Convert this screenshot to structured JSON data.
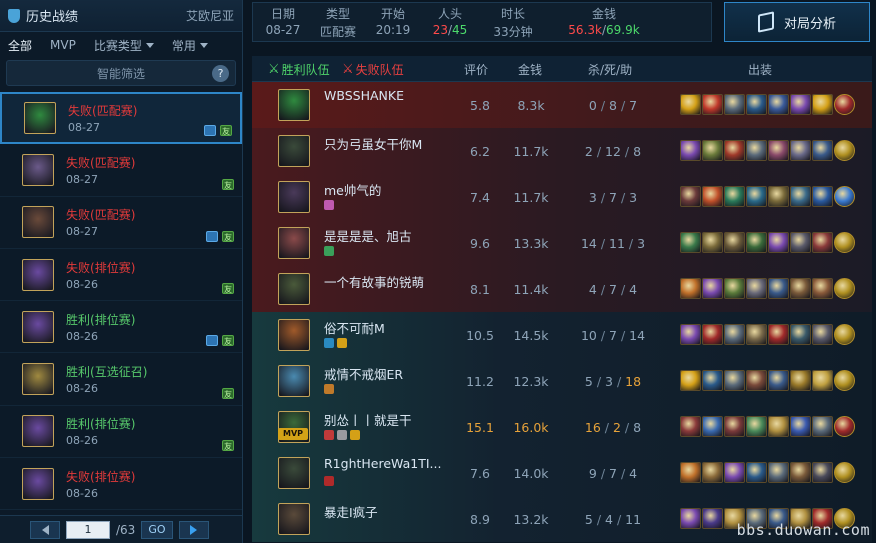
{
  "sidebar": {
    "title": "历史战绩",
    "region": "艾欧尼亚",
    "filters": [
      "全部",
      "MVP",
      "比赛类型",
      "常用"
    ],
    "smart_filter": "智能筛选",
    "help": "?",
    "matches": [
      {
        "result": "失败",
        "mode": "(匹配赛)",
        "date": "08-27",
        "outcome": "loss",
        "color": "#2f8a3f",
        "tags": [
          "img",
          "friend"
        ]
      },
      {
        "result": "失败",
        "mode": "(匹配赛)",
        "date": "08-27",
        "outcome": "loss",
        "color": "#6b5a8a",
        "tags": [
          "friend"
        ]
      },
      {
        "result": "失败",
        "mode": "(匹配赛)",
        "date": "08-27",
        "outcome": "loss",
        "color": "#6a4a3a",
        "tags": [
          "img",
          "friend"
        ]
      },
      {
        "result": "失败",
        "mode": "(排位赛)",
        "date": "08-26",
        "outcome": "loss",
        "color": "#6a4aa0",
        "tags": [
          "friend"
        ]
      },
      {
        "result": "胜利",
        "mode": "(排位赛)",
        "date": "08-26",
        "outcome": "win",
        "color": "#6a4aa0",
        "tags": [
          "img",
          "friend"
        ]
      },
      {
        "result": "胜利",
        "mode": "(互选征召)",
        "date": "08-26",
        "outcome": "win",
        "color": "#a08a40",
        "tags": [
          "friend"
        ]
      },
      {
        "result": "胜利",
        "mode": "(排位赛)",
        "date": "08-26",
        "outcome": "win",
        "color": "#6a4aa0",
        "tags": [
          "friend"
        ]
      },
      {
        "result": "失败",
        "mode": "(排位赛)",
        "date": "08-26",
        "outcome": "loss",
        "color": "#6a4aa0",
        "tags": []
      }
    ],
    "pager": {
      "page": "1",
      "total": "/63",
      "go": "GO"
    }
  },
  "info": {
    "date_label": "日期",
    "date": "08-27",
    "type_label": "类型",
    "type": "匹配赛",
    "start_label": "开始",
    "start": "20:19",
    "kills_label": "人头",
    "kills_a": "23",
    "kills_b": "45",
    "kills_sep": "/",
    "duration_label": "时长",
    "duration": "33分钟",
    "gold_label": "金钱",
    "gold_a": "56.3k",
    "gold_b": "69.9k",
    "gold_sep": "/"
  },
  "analysis_button": "对局分析",
  "table": {
    "win_team": "胜利队伍",
    "loss_team": "失败队伍",
    "col_score": "评价",
    "col_gold": "金钱",
    "col_kda": "杀/死/助",
    "col_items": "出装",
    "players": [
      {
        "name": "WBSSHANKE",
        "score": "5.8",
        "gold": "8.3k",
        "k": "0",
        "d": "8",
        "a": "7",
        "side": "loss",
        "first": true,
        "avatar": "#2f8a3f",
        "icons": [],
        "hl": [],
        "items": [
          "#d4a017",
          "#c0392b",
          "#5a6a7a",
          "#2a5a8a",
          "#3a5a9a",
          "#7a4ab0",
          "#d4a017",
          "#a02a2a"
        ]
      },
      {
        "name": "只为弓虽女干你M",
        "score": "6.2",
        "gold": "11.7k",
        "k": "2",
        "d": "12",
        "a": "8",
        "side": "loss",
        "avatar": "#3a4a3a",
        "icons": [],
        "hl": [],
        "items": [
          "#7a4ab0",
          "#6a7a3a",
          "#a03a2a",
          "#5a6a7a",
          "#8a4a6a",
          "#6a6a8a",
          "#3a5a8a",
          "#b09020"
        ]
      },
      {
        "name": "me帅气的",
        "score": "7.4",
        "gold": "11.7k",
        "k": "3",
        "d": "7",
        "a": "3",
        "side": "loss",
        "avatar": "#4a3a5a",
        "icons": [
          "#c05ab0"
        ],
        "hl": [],
        "items": [
          "#6a3a3a",
          "#c0502a",
          "#2a7a5a",
          "#2a6a8a",
          "#7a6a3a",
          "#3a6a8a",
          "#2a5aa0",
          "#3a7ad0"
        ]
      },
      {
        "name": "是是是是、旭古",
        "score": "9.6",
        "gold": "13.3k",
        "k": "14",
        "d": "11",
        "a": "3",
        "side": "loss",
        "avatar": "#8a4a4a",
        "icons": [
          "#3aa05a"
        ],
        "hl": [],
        "items": [
          "#3a7a4a",
          "#7a6a3a",
          "#6a5a3a",
          "#3a6a3a",
          "#7a4ab0",
          "#5a5a6a",
          "#8a3a3a",
          "#b09020"
        ]
      },
      {
        "name": "一个有故事的锐萌",
        "score": "8.1",
        "gold": "11.4k",
        "k": "4",
        "d": "7",
        "a": "4",
        "side": "loss",
        "avatar": "#4a5a3a",
        "icons": [],
        "hl": [],
        "items": [
          "#c0702a",
          "#7a4ab0",
          "#5a7a3a",
          "#6a6a7a",
          "#3a5a8a",
          "#7a5a3a",
          "#8a5a3a",
          "#b09020"
        ]
      },
      {
        "name": "俗不可耐M",
        "score": "10.5",
        "gold": "14.5k",
        "k": "10",
        "d": "7",
        "a": "14",
        "side": "win",
        "avatar": "#a05a2a",
        "icons": [
          "#2a8ac0",
          "#d4a017"
        ],
        "hl": [],
        "items": [
          "#7a4ab0",
          "#a02a2a",
          "#5a6a7a",
          "#7a6a4a",
          "#a02a2a",
          "#3a5a6a",
          "#5a5a6a",
          "#b09020"
        ]
      },
      {
        "name": "戒情不戒烟ER",
        "score": "11.2",
        "gold": "12.3k",
        "k": "5",
        "d": "3",
        "a": "18",
        "side": "win",
        "avatar": "#4a8ab0",
        "icons": [
          "#c07a2a"
        ],
        "hl": [
          "a"
        ],
        "items": [
          "#d4a017",
          "#2a5a8a",
          "#5a6a7a",
          "#7a4a3a",
          "#3a5a8a",
          "#9a7a2a",
          "#c0a040",
          "#b09020"
        ]
      },
      {
        "name": "别怂丨丨就是干",
        "score": "15.1",
        "gold": "16.0k",
        "k": "16",
        "d": "2",
        "a": "8",
        "side": "win",
        "mvp": true,
        "avatar": "#3a6a3a",
        "icons": [
          "#c03a3a",
          "#9a9aa0",
          "#d4a017"
        ],
        "hl": [
          "score",
          "gold",
          "k",
          "d"
        ],
        "items": [
          "#8a3a3a",
          "#3a6ab0",
          "#7a3a3a",
          "#4a8a5a",
          "#b09040",
          "#3a5ab0",
          "#5a6a7a",
          "#a02a2a"
        ]
      },
      {
        "name": "R1ghtHereWa1TI...",
        "score": "7.6",
        "gold": "14.0k",
        "k": "9",
        "d": "7",
        "a": "4",
        "side": "win",
        "avatar": "#3a4a3a",
        "icons": [
          "#b02a2a"
        ],
        "hl": [],
        "items": [
          "#c0702a",
          "#8a6a3a",
          "#7a4ab0",
          "#2a5a8a",
          "#5a6a7a",
          "#7a5a3a",
          "#4a4a5a",
          "#b09020"
        ]
      },
      {
        "name": "暴走I疯子",
        "score": "8.9",
        "gold": "13.2k",
        "k": "5",
        "d": "4",
        "a": "11",
        "side": "win",
        "avatar": "#5a4a3a",
        "icons": [],
        "hl": [],
        "items": [
          "#7a4ab0",
          "#4a3a8a",
          "#b09040",
          "#5a6a7a",
          "#3a5a8a",
          "#b09040",
          "#a02a2a",
          "#b09020"
        ]
      }
    ]
  },
  "watermark": "bbs.duowan.com"
}
